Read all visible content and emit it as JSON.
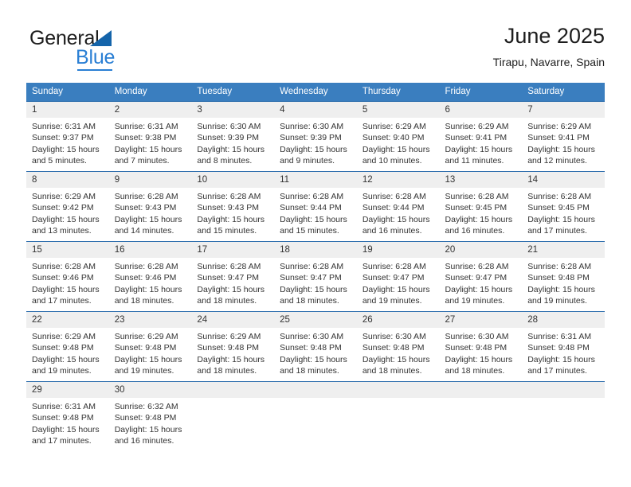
{
  "brand": {
    "name_part1": "General",
    "name_part2": "Blue",
    "logo_icon": "triangle-logo-icon"
  },
  "header": {
    "title": "June 2025",
    "location": "Tirapu, Navarre, Spain"
  },
  "calendar": {
    "weekday_headers": [
      "Sunday",
      "Monday",
      "Tuesday",
      "Wednesday",
      "Thursday",
      "Friday",
      "Saturday"
    ],
    "header_color": "#3a7ebf",
    "daynum_background": "#efefef",
    "row_border_color": "#2f6fae",
    "weeks": [
      [
        {
          "day": "1",
          "sunrise": "Sunrise: 6:31 AM",
          "sunset": "Sunset: 9:37 PM",
          "daylight": "Daylight: 15 hours and 5 minutes."
        },
        {
          "day": "2",
          "sunrise": "Sunrise: 6:31 AM",
          "sunset": "Sunset: 9:38 PM",
          "daylight": "Daylight: 15 hours and 7 minutes."
        },
        {
          "day": "3",
          "sunrise": "Sunrise: 6:30 AM",
          "sunset": "Sunset: 9:39 PM",
          "daylight": "Daylight: 15 hours and 8 minutes."
        },
        {
          "day": "4",
          "sunrise": "Sunrise: 6:30 AM",
          "sunset": "Sunset: 9:39 PM",
          "daylight": "Daylight: 15 hours and 9 minutes."
        },
        {
          "day": "5",
          "sunrise": "Sunrise: 6:29 AM",
          "sunset": "Sunset: 9:40 PM",
          "daylight": "Daylight: 15 hours and 10 minutes."
        },
        {
          "day": "6",
          "sunrise": "Sunrise: 6:29 AM",
          "sunset": "Sunset: 9:41 PM",
          "daylight": "Daylight: 15 hours and 11 minutes."
        },
        {
          "day": "7",
          "sunrise": "Sunrise: 6:29 AM",
          "sunset": "Sunset: 9:41 PM",
          "daylight": "Daylight: 15 hours and 12 minutes."
        }
      ],
      [
        {
          "day": "8",
          "sunrise": "Sunrise: 6:29 AM",
          "sunset": "Sunset: 9:42 PM",
          "daylight": "Daylight: 15 hours and 13 minutes."
        },
        {
          "day": "9",
          "sunrise": "Sunrise: 6:28 AM",
          "sunset": "Sunset: 9:43 PM",
          "daylight": "Daylight: 15 hours and 14 minutes."
        },
        {
          "day": "10",
          "sunrise": "Sunrise: 6:28 AM",
          "sunset": "Sunset: 9:43 PM",
          "daylight": "Daylight: 15 hours and 15 minutes."
        },
        {
          "day": "11",
          "sunrise": "Sunrise: 6:28 AM",
          "sunset": "Sunset: 9:44 PM",
          "daylight": "Daylight: 15 hours and 15 minutes."
        },
        {
          "day": "12",
          "sunrise": "Sunrise: 6:28 AM",
          "sunset": "Sunset: 9:44 PM",
          "daylight": "Daylight: 15 hours and 16 minutes."
        },
        {
          "day": "13",
          "sunrise": "Sunrise: 6:28 AM",
          "sunset": "Sunset: 9:45 PM",
          "daylight": "Daylight: 15 hours and 16 minutes."
        },
        {
          "day": "14",
          "sunrise": "Sunrise: 6:28 AM",
          "sunset": "Sunset: 9:45 PM",
          "daylight": "Daylight: 15 hours and 17 minutes."
        }
      ],
      [
        {
          "day": "15",
          "sunrise": "Sunrise: 6:28 AM",
          "sunset": "Sunset: 9:46 PM",
          "daylight": "Daylight: 15 hours and 17 minutes."
        },
        {
          "day": "16",
          "sunrise": "Sunrise: 6:28 AM",
          "sunset": "Sunset: 9:46 PM",
          "daylight": "Daylight: 15 hours and 18 minutes."
        },
        {
          "day": "17",
          "sunrise": "Sunrise: 6:28 AM",
          "sunset": "Sunset: 9:47 PM",
          "daylight": "Daylight: 15 hours and 18 minutes."
        },
        {
          "day": "18",
          "sunrise": "Sunrise: 6:28 AM",
          "sunset": "Sunset: 9:47 PM",
          "daylight": "Daylight: 15 hours and 18 minutes."
        },
        {
          "day": "19",
          "sunrise": "Sunrise: 6:28 AM",
          "sunset": "Sunset: 9:47 PM",
          "daylight": "Daylight: 15 hours and 19 minutes."
        },
        {
          "day": "20",
          "sunrise": "Sunrise: 6:28 AM",
          "sunset": "Sunset: 9:47 PM",
          "daylight": "Daylight: 15 hours and 19 minutes."
        },
        {
          "day": "21",
          "sunrise": "Sunrise: 6:28 AM",
          "sunset": "Sunset: 9:48 PM",
          "daylight": "Daylight: 15 hours and 19 minutes."
        }
      ],
      [
        {
          "day": "22",
          "sunrise": "Sunrise: 6:29 AM",
          "sunset": "Sunset: 9:48 PM",
          "daylight": "Daylight: 15 hours and 19 minutes."
        },
        {
          "day": "23",
          "sunrise": "Sunrise: 6:29 AM",
          "sunset": "Sunset: 9:48 PM",
          "daylight": "Daylight: 15 hours and 19 minutes."
        },
        {
          "day": "24",
          "sunrise": "Sunrise: 6:29 AM",
          "sunset": "Sunset: 9:48 PM",
          "daylight": "Daylight: 15 hours and 18 minutes."
        },
        {
          "day": "25",
          "sunrise": "Sunrise: 6:30 AM",
          "sunset": "Sunset: 9:48 PM",
          "daylight": "Daylight: 15 hours and 18 minutes."
        },
        {
          "day": "26",
          "sunrise": "Sunrise: 6:30 AM",
          "sunset": "Sunset: 9:48 PM",
          "daylight": "Daylight: 15 hours and 18 minutes."
        },
        {
          "day": "27",
          "sunrise": "Sunrise: 6:30 AM",
          "sunset": "Sunset: 9:48 PM",
          "daylight": "Daylight: 15 hours and 18 minutes."
        },
        {
          "day": "28",
          "sunrise": "Sunrise: 6:31 AM",
          "sunset": "Sunset: 9:48 PM",
          "daylight": "Daylight: 15 hours and 17 minutes."
        }
      ],
      [
        {
          "day": "29",
          "sunrise": "Sunrise: 6:31 AM",
          "sunset": "Sunset: 9:48 PM",
          "daylight": "Daylight: 15 hours and 17 minutes."
        },
        {
          "day": "30",
          "sunrise": "Sunrise: 6:32 AM",
          "sunset": "Sunset: 9:48 PM",
          "daylight": "Daylight: 15 hours and 16 minutes."
        },
        {
          "day": "",
          "sunrise": "",
          "sunset": "",
          "daylight": ""
        },
        {
          "day": "",
          "sunrise": "",
          "sunset": "",
          "daylight": ""
        },
        {
          "day": "",
          "sunrise": "",
          "sunset": "",
          "daylight": ""
        },
        {
          "day": "",
          "sunrise": "",
          "sunset": "",
          "daylight": ""
        },
        {
          "day": "",
          "sunrise": "",
          "sunset": "",
          "daylight": ""
        }
      ]
    ]
  }
}
